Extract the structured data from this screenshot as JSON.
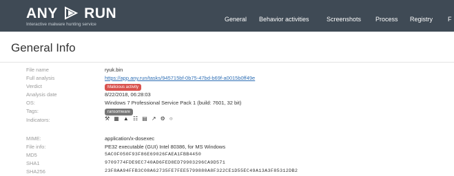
{
  "header": {
    "logo_left": "ANY",
    "logo_right": "RUN",
    "tagline": "Interactive malware hunting service",
    "nav": [
      "General",
      "Behavior activities",
      "Screenshots",
      "Process",
      "Registry",
      "F"
    ]
  },
  "general": {
    "title": "General Info",
    "rows": [
      {
        "label": "File name",
        "value": "ryuk.bin"
      },
      {
        "label": "Full analysis",
        "value": "https://app.any.run/tasks/945715bf-0b75-47bd-b69f-a0015b0ff49e"
      },
      {
        "label": "Verdict",
        "value": "Malicious activity"
      },
      {
        "label": "Analysis date",
        "value": "8/22/2018, 06:28:03"
      },
      {
        "label": "OS:",
        "value": "Windows 7 Professional Service Pack 1 (build: 7601, 32 bit)"
      },
      {
        "label": "Tags:",
        "value": "ransomware"
      },
      {
        "label": "Indicators:",
        "value": ""
      },
      {
        "label": "MIME:",
        "value": "application/x-dosexec"
      },
      {
        "label": "File info:",
        "value": "PE32 executable (GUI) Intel 80386, for MS Windows"
      },
      {
        "label": "MD5",
        "value": "5AC0F050F93F86E69026FAEA1FBB4450"
      },
      {
        "label": "SHA1",
        "value": "9709774FDE9EC740AD6FED8ED79903296CA9D571"
      },
      {
        "label": "SHA256",
        "value": "23F8AA94FFB3C08A62735FE7FEE5799880A8F322CE1D55EC49A13A3F85312DB2"
      }
    ],
    "indicator_icons": [
      "wrench-icon",
      "spreadsheet-icon",
      "warning-icon",
      "network-icon",
      "document-icon",
      "antenna-icon",
      "gear-icon",
      "lock-icon"
    ]
  },
  "colors": {
    "header_bg": "#3f4a55",
    "verdict": "#d9534f",
    "tag": "#777777",
    "link": "#2f6fb5"
  }
}
